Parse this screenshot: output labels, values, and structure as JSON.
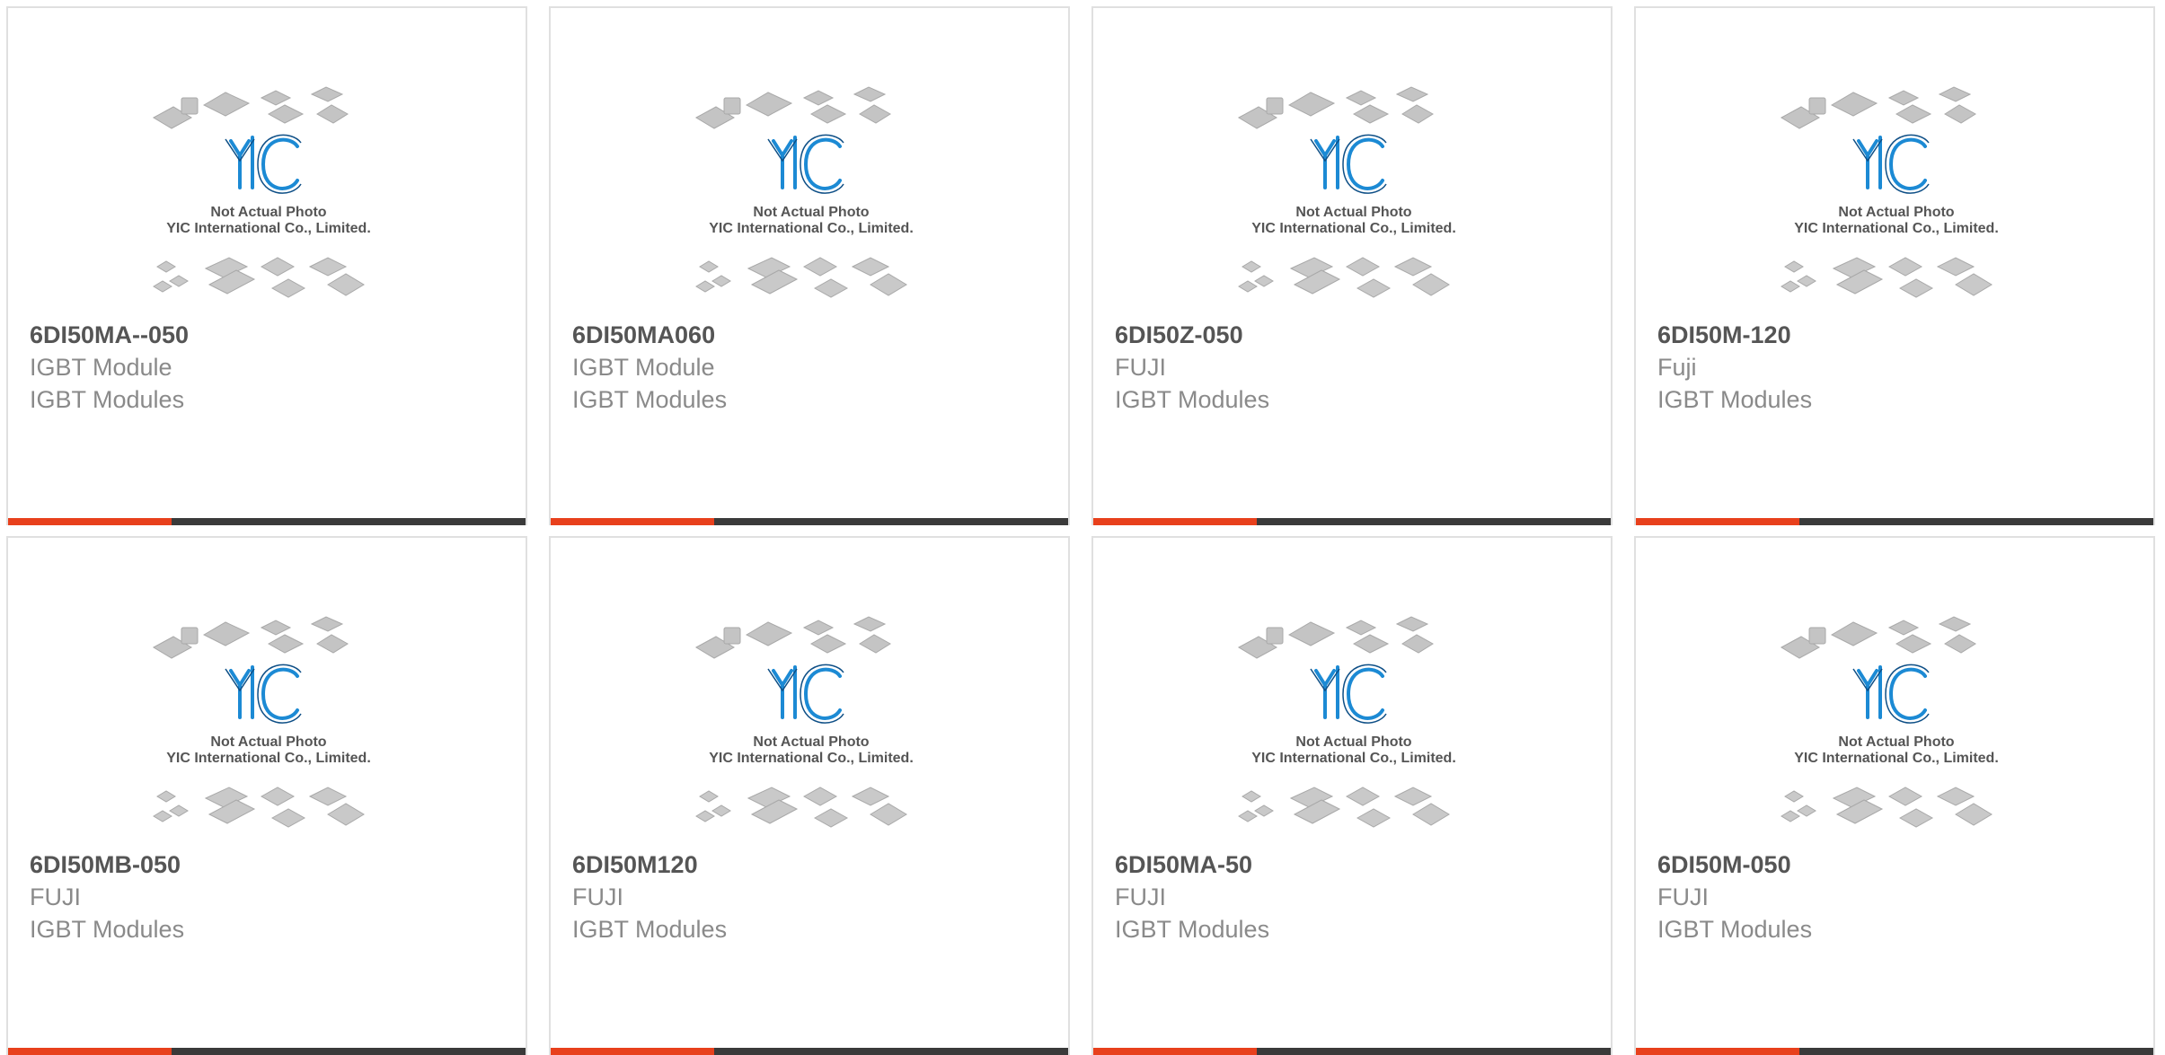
{
  "products": [
    {
      "part": "6DI50MA--050",
      "manufacturer": "IGBT Module",
      "category": "IGBT Modules"
    },
    {
      "part": "6DI50MA060",
      "manufacturer": "IGBT Module",
      "category": "IGBT Modules"
    },
    {
      "part": "6DI50Z-050",
      "manufacturer": "FUJI",
      "category": "IGBT Modules"
    },
    {
      "part": "6DI50M-120",
      "manufacturer": "Fuji",
      "category": "IGBT Modules"
    },
    {
      "part": "6DI50MB-050",
      "manufacturer": "FUJI",
      "category": "IGBT Modules"
    },
    {
      "part": "6DI50M120",
      "manufacturer": "FUJI",
      "category": "IGBT Modules"
    },
    {
      "part": "6DI50MA-50",
      "manufacturer": "FUJI",
      "category": "IGBT Modules"
    },
    {
      "part": "6DI50M-050",
      "manufacturer": "FUJI",
      "category": "IGBT Modules"
    }
  ],
  "placeholder": {
    "logo_text": "YIC",
    "line1": "Not Actual Photo",
    "line2": "YIC International Co., Limited."
  },
  "colors": {
    "accent": "#e8401c",
    "bar": "#3a3a3a",
    "logo": "#1c8ad4"
  }
}
